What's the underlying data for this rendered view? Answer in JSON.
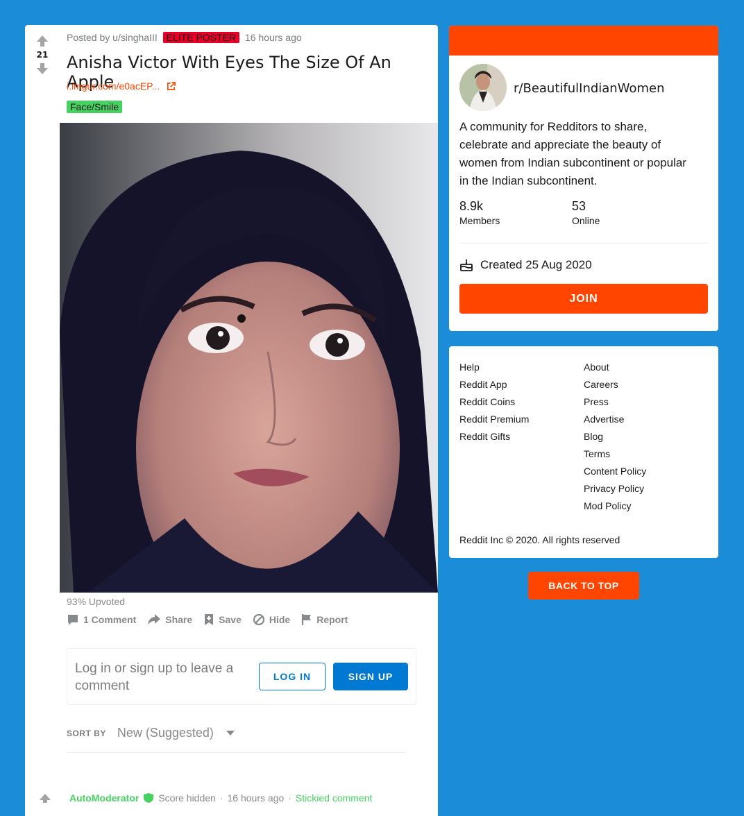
{
  "post": {
    "score": "21",
    "posted_by": "Posted by u/singhaIII",
    "author_badge": "ELITE POSTER",
    "time": "16 hours ago",
    "title": "Anisha Victor With Eyes The Size Of An Apple",
    "link": "i.imgur.com/e0acEP...",
    "flair": "Face/Smile",
    "upvoted": "93% Upvoted",
    "actions": {
      "comments": "1 Comment",
      "share": "Share",
      "save": "Save",
      "hide": "Hide",
      "report": "Report"
    },
    "colors": {
      "flair_bg": "#46d160",
      "badge_bg": "#ea0027",
      "accent": "#ff4500"
    }
  },
  "login_prompt": {
    "text": "Log in or sign up to leave a comment",
    "login": "LOG IN",
    "signup": "SIGN UP"
  },
  "sort": {
    "label": "SORT BY",
    "value": "New (Suggested)"
  },
  "comment": {
    "author": "AutoModerator",
    "score": "Score hidden",
    "time": "16 hours ago",
    "tag": "Stickied comment",
    "sep": "·"
  },
  "about": {
    "name": "r/BeautifulIndianWomen",
    "description": "A community for Redditors to share, celebrate and appreciate the beauty of women from Indian subcontinent or popular in the Indian subcontinent.",
    "members_count": "8.9k",
    "members_label": "Members",
    "online_count": "53",
    "online_label": "Online",
    "created": "Created 25 Aug 2020",
    "join": "JOIN"
  },
  "footer": {
    "col1": [
      "Help",
      "Reddit App",
      "Reddit Coins",
      "Reddit Premium",
      "Reddit Gifts"
    ],
    "col2": [
      "About",
      "Careers",
      "Press",
      "Advertise",
      "Blog",
      "Terms",
      "Content Policy",
      "Privacy Policy",
      "Mod Policy"
    ],
    "copyright": "Reddit Inc © 2020. All rights reserved"
  },
  "back_to_top": "BACK TO TOP"
}
